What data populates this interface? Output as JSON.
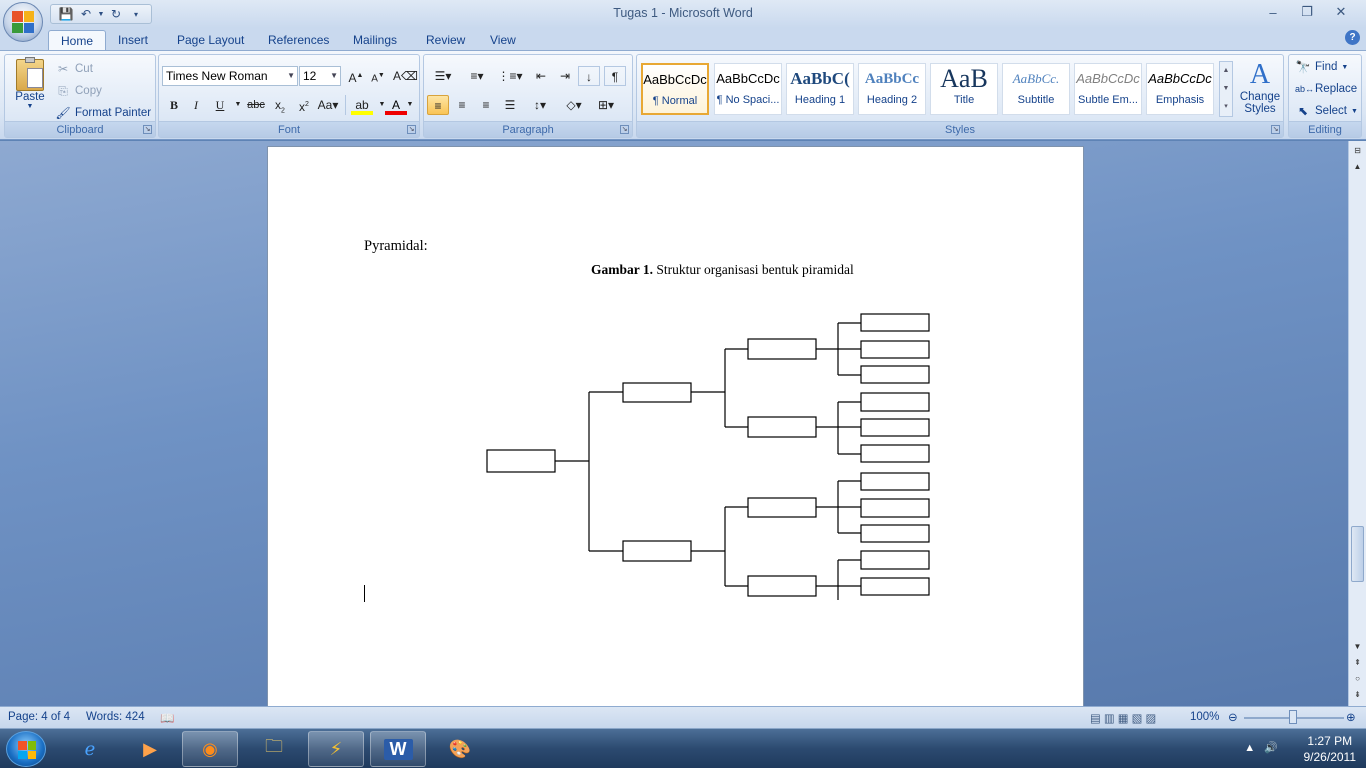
{
  "window": {
    "title": "Tugas 1 - Microsoft Word"
  },
  "window_buttons": {
    "minimize": "–",
    "restore": "❐",
    "close": "✕"
  },
  "tabs": [
    "Home",
    "Insert",
    "Page Layout",
    "References",
    "Mailings",
    "Review",
    "View"
  ],
  "clipboard": {
    "label": "Clipboard",
    "paste": "Paste",
    "cut": "Cut",
    "copy": "Copy",
    "format_painter": "Format Painter"
  },
  "font": {
    "label": "Font",
    "family": "Times New Roman",
    "size": "12"
  },
  "paragraph": {
    "label": "Paragraph"
  },
  "styles": {
    "label": "Styles",
    "items": [
      {
        "sample": "AaBbCcDc",
        "name": "¶ Normal"
      },
      {
        "sample": "AaBbCcDc",
        "name": "¶ No Spaci..."
      },
      {
        "sample": "AaBbC(",
        "name": "Heading 1"
      },
      {
        "sample": "AaBbCc",
        "name": "Heading 2"
      },
      {
        "sample": "AaB",
        "name": "Title"
      },
      {
        "sample": "AaBbCc.",
        "name": "Subtitle"
      },
      {
        "sample": "AaBbCcDc",
        "name": "Subtle Em..."
      },
      {
        "sample": "AaBbCcDc",
        "name": "Emphasis"
      }
    ],
    "change_styles": "Change Styles"
  },
  "editing": {
    "label": "Editing",
    "find": "Find",
    "replace": "Replace",
    "select": "Select"
  },
  "document": {
    "heading": "Pyramidal:",
    "caption_bold": "Gambar 1.",
    "caption_text": " Struktur organisasi bentuk piramidal"
  },
  "status": {
    "page": "Page: 4 of 4",
    "words": "Words: 424",
    "zoom": "100%"
  },
  "taskbar": {
    "time": "1:27 PM",
    "date": "9/26/2011"
  },
  "colors": {
    "accent": "#15428b",
    "selected_style_border": "#e8a834"
  }
}
